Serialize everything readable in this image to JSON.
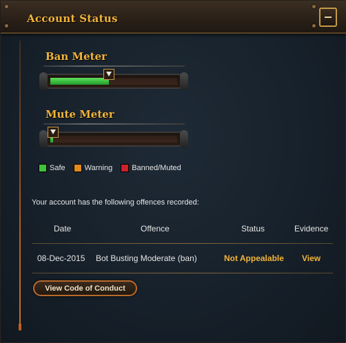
{
  "header": {
    "title": "Account Status"
  },
  "ban_meter": {
    "title": "Ban Meter",
    "level": 0.46
  },
  "mute_meter": {
    "title": "Mute Meter",
    "level": 0.02
  },
  "legend": [
    {
      "label": "Safe",
      "color": "#3fc33a"
    },
    {
      "label": "Warning",
      "color": "#e08a1e"
    },
    {
      "label": "Banned/Muted",
      "color": "#d0202a"
    }
  ],
  "offences": {
    "intro": "Your account has the following offences recorded:",
    "columns": {
      "date": "Date",
      "offence": "Offence",
      "status": "Status",
      "evidence": "Evidence"
    },
    "rows": [
      {
        "date": "08-Dec-2015",
        "offence": "Bot Busting Moderate (ban)",
        "status": "Not Appealable",
        "evidence": "View"
      }
    ]
  },
  "code_of_conduct_button": "View Code of Conduct",
  "colors": {
    "accent": "#f3b43a",
    "meter_fill": "#3fc33a"
  }
}
